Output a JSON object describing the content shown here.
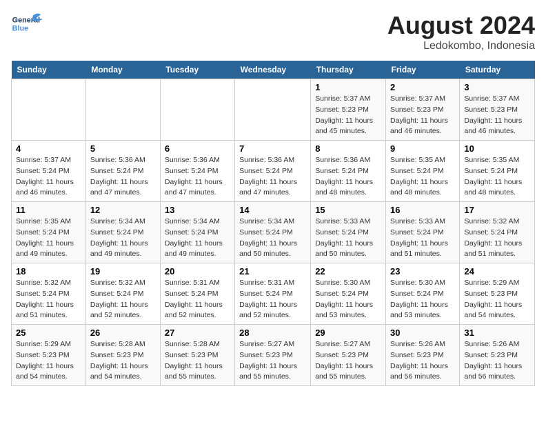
{
  "header": {
    "logo_line1": "General",
    "logo_line2": "Blue",
    "month": "August 2024",
    "location": "Ledokombo, Indonesia"
  },
  "weekdays": [
    "Sunday",
    "Monday",
    "Tuesday",
    "Wednesday",
    "Thursday",
    "Friday",
    "Saturday"
  ],
  "weeks": [
    [
      {
        "day": "",
        "info": ""
      },
      {
        "day": "",
        "info": ""
      },
      {
        "day": "",
        "info": ""
      },
      {
        "day": "",
        "info": ""
      },
      {
        "day": "1",
        "info": "Sunrise: 5:37 AM\nSunset: 5:23 PM\nDaylight: 11 hours\nand 45 minutes."
      },
      {
        "day": "2",
        "info": "Sunrise: 5:37 AM\nSunset: 5:23 PM\nDaylight: 11 hours\nand 46 minutes."
      },
      {
        "day": "3",
        "info": "Sunrise: 5:37 AM\nSunset: 5:23 PM\nDaylight: 11 hours\nand 46 minutes."
      }
    ],
    [
      {
        "day": "4",
        "info": "Sunrise: 5:37 AM\nSunset: 5:24 PM\nDaylight: 11 hours\nand 46 minutes."
      },
      {
        "day": "5",
        "info": "Sunrise: 5:36 AM\nSunset: 5:24 PM\nDaylight: 11 hours\nand 47 minutes."
      },
      {
        "day": "6",
        "info": "Sunrise: 5:36 AM\nSunset: 5:24 PM\nDaylight: 11 hours\nand 47 minutes."
      },
      {
        "day": "7",
        "info": "Sunrise: 5:36 AM\nSunset: 5:24 PM\nDaylight: 11 hours\nand 47 minutes."
      },
      {
        "day": "8",
        "info": "Sunrise: 5:36 AM\nSunset: 5:24 PM\nDaylight: 11 hours\nand 48 minutes."
      },
      {
        "day": "9",
        "info": "Sunrise: 5:35 AM\nSunset: 5:24 PM\nDaylight: 11 hours\nand 48 minutes."
      },
      {
        "day": "10",
        "info": "Sunrise: 5:35 AM\nSunset: 5:24 PM\nDaylight: 11 hours\nand 48 minutes."
      }
    ],
    [
      {
        "day": "11",
        "info": "Sunrise: 5:35 AM\nSunset: 5:24 PM\nDaylight: 11 hours\nand 49 minutes."
      },
      {
        "day": "12",
        "info": "Sunrise: 5:34 AM\nSunset: 5:24 PM\nDaylight: 11 hours\nand 49 minutes."
      },
      {
        "day": "13",
        "info": "Sunrise: 5:34 AM\nSunset: 5:24 PM\nDaylight: 11 hours\nand 49 minutes."
      },
      {
        "day": "14",
        "info": "Sunrise: 5:34 AM\nSunset: 5:24 PM\nDaylight: 11 hours\nand 50 minutes."
      },
      {
        "day": "15",
        "info": "Sunrise: 5:33 AM\nSunset: 5:24 PM\nDaylight: 11 hours\nand 50 minutes."
      },
      {
        "day": "16",
        "info": "Sunrise: 5:33 AM\nSunset: 5:24 PM\nDaylight: 11 hours\nand 51 minutes."
      },
      {
        "day": "17",
        "info": "Sunrise: 5:32 AM\nSunset: 5:24 PM\nDaylight: 11 hours\nand 51 minutes."
      }
    ],
    [
      {
        "day": "18",
        "info": "Sunrise: 5:32 AM\nSunset: 5:24 PM\nDaylight: 11 hours\nand 51 minutes."
      },
      {
        "day": "19",
        "info": "Sunrise: 5:32 AM\nSunset: 5:24 PM\nDaylight: 11 hours\nand 52 minutes."
      },
      {
        "day": "20",
        "info": "Sunrise: 5:31 AM\nSunset: 5:24 PM\nDaylight: 11 hours\nand 52 minutes."
      },
      {
        "day": "21",
        "info": "Sunrise: 5:31 AM\nSunset: 5:24 PM\nDaylight: 11 hours\nand 52 minutes."
      },
      {
        "day": "22",
        "info": "Sunrise: 5:30 AM\nSunset: 5:24 PM\nDaylight: 11 hours\nand 53 minutes."
      },
      {
        "day": "23",
        "info": "Sunrise: 5:30 AM\nSunset: 5:24 PM\nDaylight: 11 hours\nand 53 minutes."
      },
      {
        "day": "24",
        "info": "Sunrise: 5:29 AM\nSunset: 5:23 PM\nDaylight: 11 hours\nand 54 minutes."
      }
    ],
    [
      {
        "day": "25",
        "info": "Sunrise: 5:29 AM\nSunset: 5:23 PM\nDaylight: 11 hours\nand 54 minutes."
      },
      {
        "day": "26",
        "info": "Sunrise: 5:28 AM\nSunset: 5:23 PM\nDaylight: 11 hours\nand 54 minutes."
      },
      {
        "day": "27",
        "info": "Sunrise: 5:28 AM\nSunset: 5:23 PM\nDaylight: 11 hours\nand 55 minutes."
      },
      {
        "day": "28",
        "info": "Sunrise: 5:27 AM\nSunset: 5:23 PM\nDaylight: 11 hours\nand 55 minutes."
      },
      {
        "day": "29",
        "info": "Sunrise: 5:27 AM\nSunset: 5:23 PM\nDaylight: 11 hours\nand 55 minutes."
      },
      {
        "day": "30",
        "info": "Sunrise: 5:26 AM\nSunset: 5:23 PM\nDaylight: 11 hours\nand 56 minutes."
      },
      {
        "day": "31",
        "info": "Sunrise: 5:26 AM\nSunset: 5:23 PM\nDaylight: 11 hours\nand 56 minutes."
      }
    ]
  ]
}
